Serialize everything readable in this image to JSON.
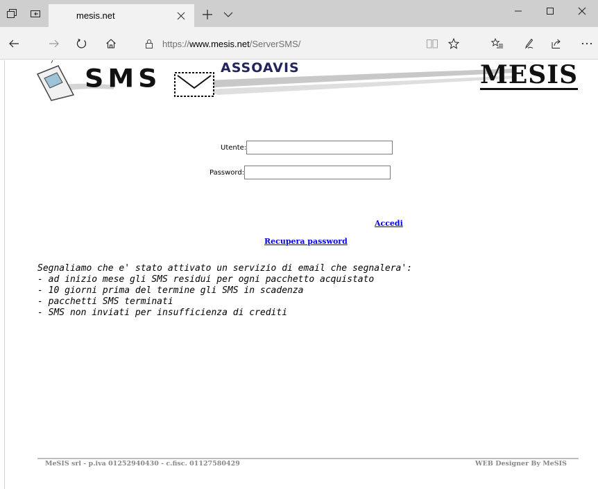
{
  "browser": {
    "tab_title": "mesis.net",
    "url_prefix": "https://",
    "url_domain": "www.mesis.net",
    "url_path": "/ServerSMS/"
  },
  "banner": {
    "sms_text": "SMS",
    "assoavis_text": "ASSOAVIS",
    "mesis_logo": "MESIS"
  },
  "login": {
    "user_label": "Utente:",
    "user_value": "",
    "password_label": "Password:",
    "password_value": "",
    "submit_link": "Accedi",
    "recover_link": "Recupera password"
  },
  "notice": {
    "lines": [
      "Segnaliamo che e' stato attivato un servizio di email che segnalera':",
      "- ad inizio mese gli SMS residui per ogni pacchetto acquistato",
      "- 10 giorni prima del termine gli SMS in scadenza",
      "- pacchetti SMS terminati",
      "- SMS non inviati per insufficienza di crediti"
    ]
  },
  "footer": {
    "left": "MeSIS srl - p.iva 01252940430 - c.fisc. 01127580429",
    "right": "WEB Designer By MeSIS"
  },
  "icons": {
    "tab_actions": "tab-actions-icon",
    "tab_aside": "tab-aside-icon",
    "back": "back-arrow-icon",
    "forward": "forward-arrow-icon",
    "refresh": "refresh-icon",
    "home": "home-icon",
    "lock": "lock-icon",
    "reading_view": "reading-view-icon",
    "favorite": "star-icon",
    "favorites": "favorites-list-icon",
    "notes": "pen-icon",
    "share": "share-icon",
    "more": "more-icon"
  },
  "colors": {
    "link": "#0000ee",
    "tabbar": "#cfcfcf",
    "navbar": "#f2f2f2",
    "footer_text": "#888888"
  }
}
